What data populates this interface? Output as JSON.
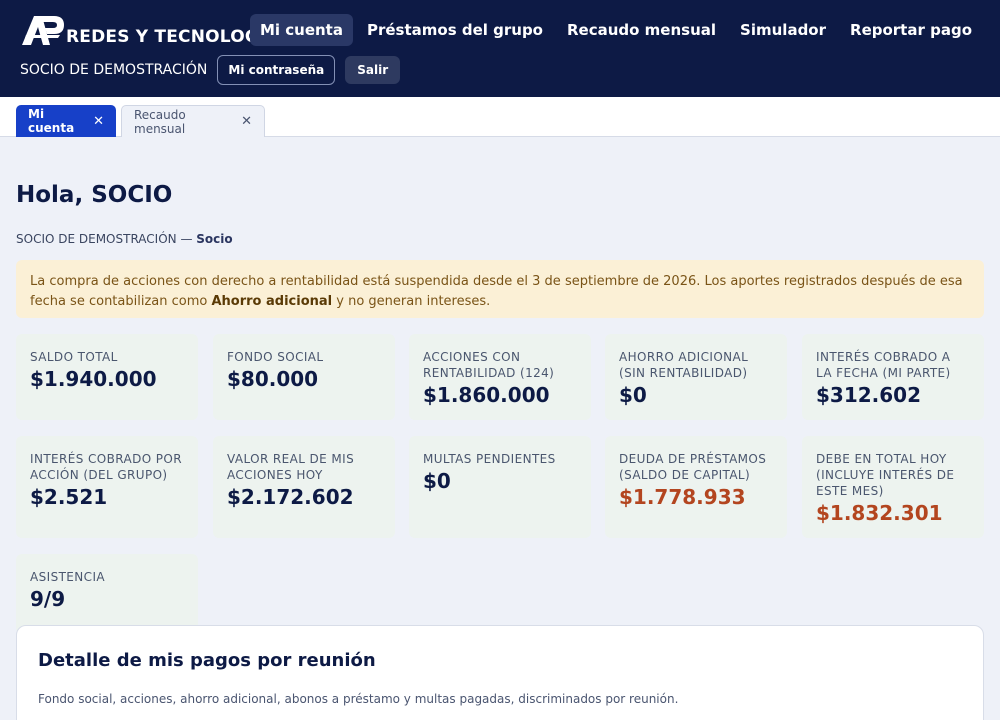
{
  "header": {
    "brand": "REDES Y TECNOLOGÍA",
    "nav": [
      {
        "label": "Mi cuenta",
        "active": true
      },
      {
        "label": "Préstamos del grupo",
        "active": false
      },
      {
        "label": "Recaudo mensual",
        "active": false
      },
      {
        "label": "Simulador",
        "active": false
      },
      {
        "label": "Reportar pago",
        "active": false
      }
    ],
    "user_name": "SOCIO DE DEMOSTRACIÓN",
    "password_button": "Mi contraseña",
    "logout_button": "Salir"
  },
  "tabs": [
    {
      "label": "Mi cuenta",
      "close": "✕"
    },
    {
      "label": "Recaudo mensual",
      "close": "✕"
    }
  ],
  "main": {
    "greeting": "Hola, SOCIO",
    "subtitle_name": "SOCIO DE DEMOSTRACIÓN —",
    "subtitle_role": "Socio",
    "notice_text": "La compra de acciones con derecho a rentabilidad está suspendida desde el 3 de septiembre de 2026. Los aportes registrados después de esa fecha se contabilizan como",
    "notice_bold": "Ahorro adicional",
    "notice_tail": "y no generan intereses.",
    "cards": [
      {
        "label": "SALDO TOTAL",
        "value": "$1.940.000"
      },
      {
        "label": "FONDO SOCIAL",
        "value": "$80.000"
      },
      {
        "label": "ACCIONES CON RENTABILIDAD (124)",
        "value": "$1.860.000"
      },
      {
        "label": "AHORRO ADICIONAL (SIN RENTABILIDAD)",
        "value": "$0"
      },
      {
        "label": "INTERÉS COBRADO A LA FECHA (MI PARTE)",
        "value": "$312.602"
      },
      {
        "label": "INTERÉS COBRADO POR ACCIÓN (DEL GRUPO)",
        "value": "$2.521"
      },
      {
        "label": "VALOR REAL DE MIS ACCIONES HOY",
        "value": "$2.172.602"
      },
      {
        "label": "MULTAS PENDIENTES",
        "value": "$0"
      },
      {
        "label": "DEUDA DE PRÉSTAMOS (SALDO DE CAPITAL)",
        "value": "$1.778.933"
      },
      {
        "label": "DEBE EN TOTAL HOY (INCLUYE INTERÉS DE ESTE MES)",
        "value": "$1.832.301"
      },
      {
        "label": "ASISTENCIA",
        "value": "9/9"
      }
    ],
    "panel_title": "Detalle de mis pagos por reunión",
    "panel_desc": "Fondo social, acciones, ahorro adicional, abonos a préstamo y multas pagadas, discriminados por reunión."
  },
  "colors": {
    "header_bg": "#0d1a45",
    "active_tab": "#1740c8",
    "debt_value": "#b3451f",
    "notice_bg": "#fbf0d6",
    "card_bg": "#edf3ef"
  }
}
